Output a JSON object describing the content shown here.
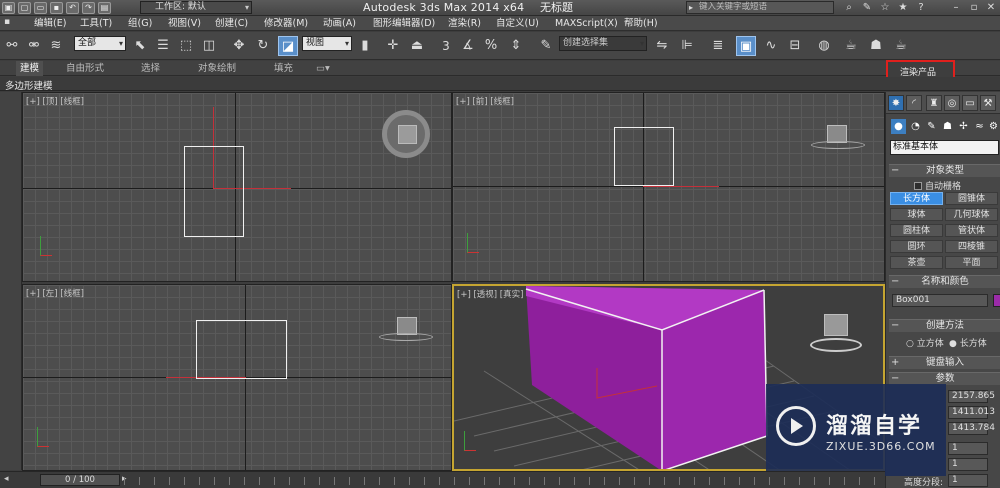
{
  "titlebar": {
    "workspace": "工作区: 默认",
    "app_title": "Autodesk 3ds Max  2014 x64",
    "doc_title": "无标题",
    "search_placeholder": "键入关键字或短语"
  },
  "menu": [
    "编辑(E)",
    "工具(T)",
    "组(G)",
    "视图(V)",
    "创建(C)",
    "修改器(M)",
    "动画(A)",
    "图形编辑器(D)",
    "渲染(R)",
    "自定义(U)",
    "MAXScript(X)",
    "帮助(H)"
  ],
  "toolbar": {
    "filter": "全部",
    "coord": "视图",
    "snap_label": "3",
    "selection_set": "创建选择集"
  },
  "ribbon": {
    "tabs": [
      "建模",
      "自由形式",
      "选择",
      "对象绘制",
      "填充"
    ],
    "render_product": "渲染产品",
    "sub_label": "多边形建模"
  },
  "viewports": {
    "top": "[+] [顶] [线框]",
    "front": "[+] [前] [线框]",
    "left": "[+] [左] [线框]",
    "persp": "[+] [透视] [真实]"
  },
  "command_panel": {
    "category": "标准基本体",
    "object_type_title": "对象类型",
    "autogrid": "自动栅格",
    "buttons": [
      "长方体",
      "圆锥体",
      "球体",
      "几何球体",
      "圆柱体",
      "管状体",
      "圆环",
      "四棱锥",
      "茶壶",
      "平面"
    ],
    "name_color_title": "名称和颜色",
    "object_name": "Box001",
    "creation_method_title": "创建方法",
    "radio_cube": "立方体",
    "radio_box": "长方体",
    "keyboard_title": "键盘输入",
    "params_title": "参数",
    "length": "2157.865",
    "width": "1411.013",
    "height": "1413.784",
    "seg1": "1",
    "seg2": "1",
    "height_seg_label": "高度分段:",
    "height_seg": "1",
    "accent": "#3a8ee3",
    "object_color": "#9b2ba8"
  },
  "timeline": {
    "frame": "0 / 100"
  },
  "watermark": {
    "title": "溜溜自学",
    "sub": "ZIXUE.3D66.COM"
  }
}
